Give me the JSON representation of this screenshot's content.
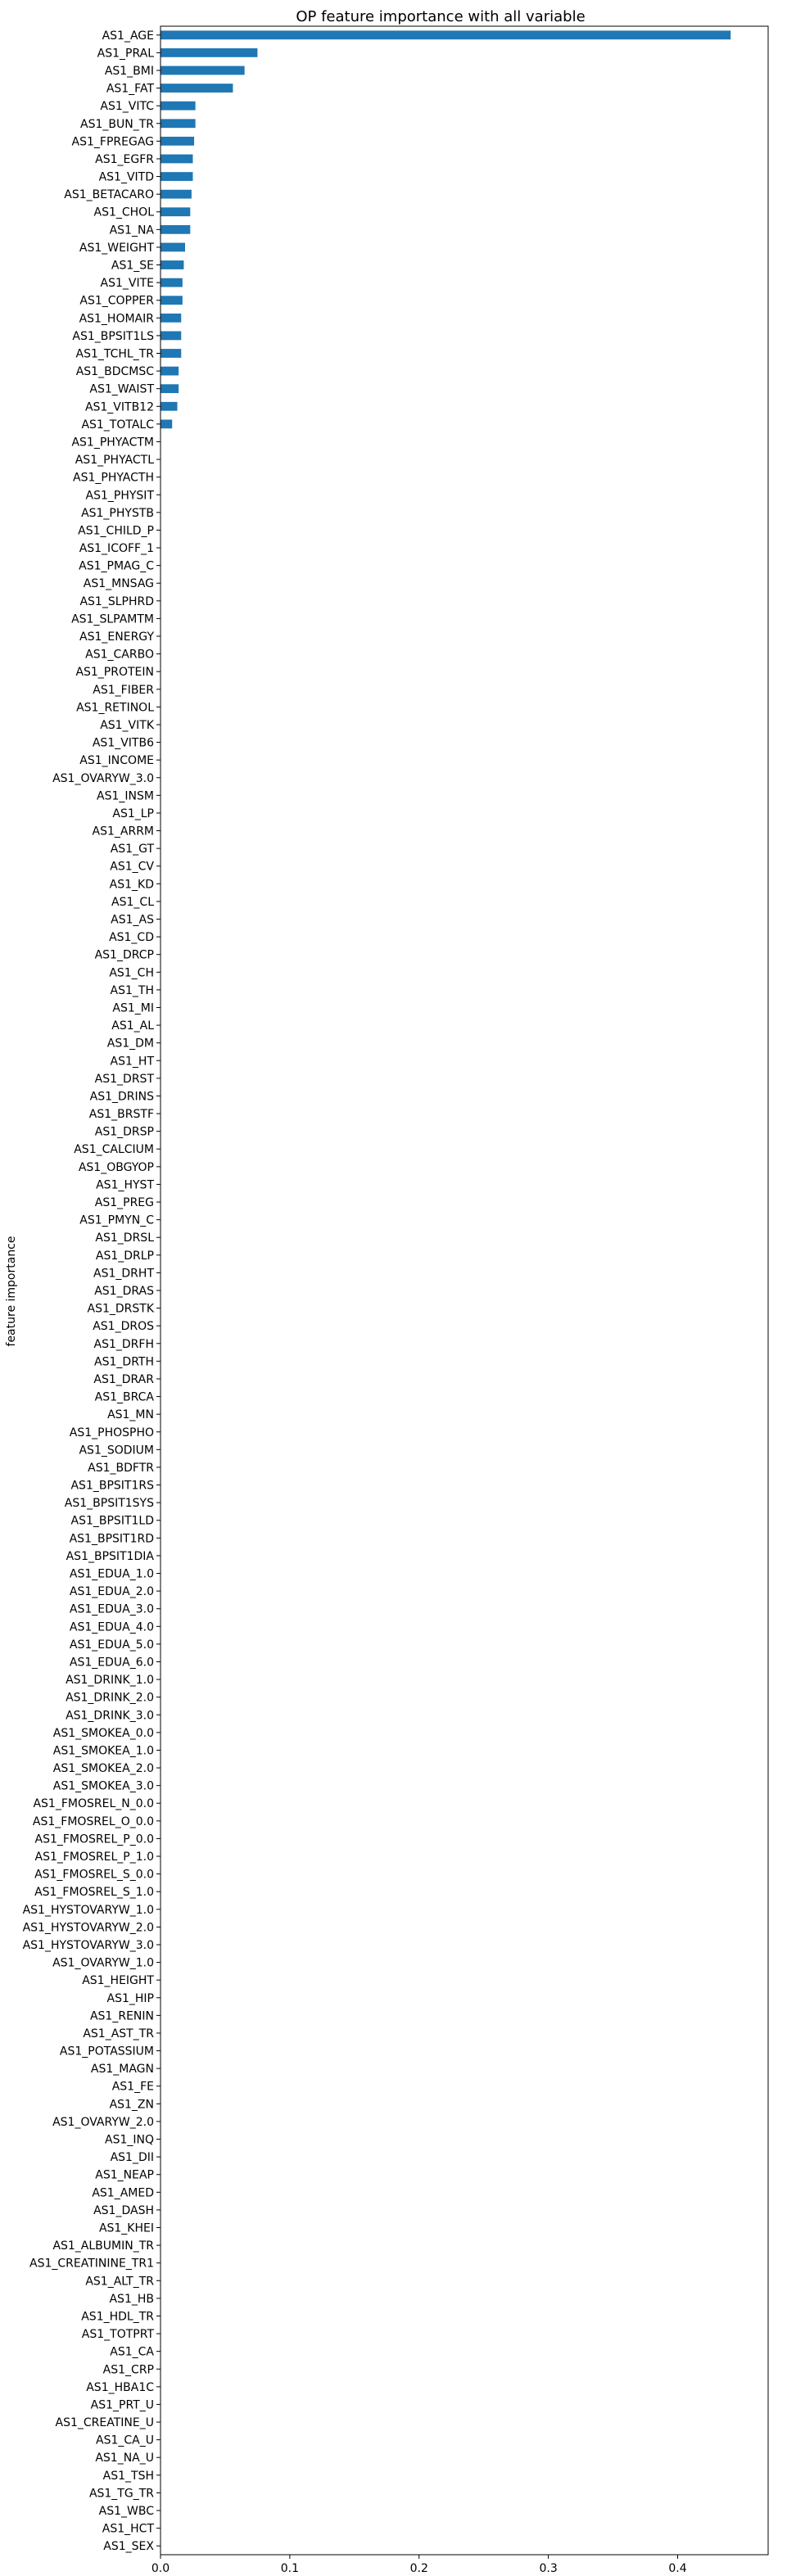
{
  "chart_data": {
    "type": "bar",
    "orientation": "horizontal",
    "title": "OP feature importance with all variable",
    "xlabel": "",
    "ylabel": "feature importance",
    "xlim": [
      0,
      0.47
    ],
    "xticks": [
      "0.0",
      "0.1",
      "0.2",
      "0.3",
      "0.4"
    ],
    "xtick_values": [
      0,
      0.1,
      0.2,
      0.3,
      0.4
    ],
    "grid": false,
    "bar_color": "#1f77b4",
    "categories": [
      "AS1_AGE",
      "AS1_PRAL",
      "AS1_BMI",
      "AS1_FAT",
      "AS1_VITC",
      "AS1_BUN_TR",
      "AS1_FPREGAG",
      "AS1_EGFR",
      "AS1_VITD",
      "AS1_BETACARO",
      "AS1_CHOL",
      "AS1_NA",
      "AS1_WEIGHT",
      "AS1_SE",
      "AS1_VITE",
      "AS1_COPPER",
      "AS1_HOMAIR",
      "AS1_BPSIT1LS",
      "AS1_TCHL_TR",
      "AS1_BDCMSC",
      "AS1_WAIST",
      "AS1_VITB12",
      "AS1_TOTALC",
      "AS1_PHYACTM",
      "AS1_PHYACTL",
      "AS1_PHYACTH",
      "AS1_PHYSIT",
      "AS1_PHYSTB",
      "AS1_CHILD_P",
      "AS1_ICOFF_1",
      "AS1_PMAG_C",
      "AS1_MNSAG",
      "AS1_SLPHRD",
      "AS1_SLPAMTM",
      "AS1_ENERGY",
      "AS1_CARBO",
      "AS1_PROTEIN",
      "AS1_FIBER",
      "AS1_RETINOL",
      "AS1_VITK",
      "AS1_VITB6",
      "AS1_INCOME",
      "AS1_OVARYW_3.0",
      "AS1_INSM",
      "AS1_LP",
      "AS1_ARRM",
      "AS1_GT",
      "AS1_CV",
      "AS1_KD",
      "AS1_CL",
      "AS1_AS",
      "AS1_CD",
      "AS1_DRCP",
      "AS1_CH",
      "AS1_TH",
      "AS1_MI",
      "AS1_AL",
      "AS1_DM",
      "AS1_HT",
      "AS1_DRST",
      "AS1_DRINS",
      "AS1_BRSTF",
      "AS1_DRSP",
      "AS1_CALCIUM",
      "AS1_OBGYOP",
      "AS1_HYST",
      "AS1_PREG",
      "AS1_PMYN_C",
      "AS1_DRSL",
      "AS1_DRLP",
      "AS1_DRHT",
      "AS1_DRAS",
      "AS1_DRSTK",
      "AS1_DROS",
      "AS1_DRFH",
      "AS1_DRTH",
      "AS1_DRAR",
      "AS1_BRCA",
      "AS1_MN",
      "AS1_PHOSPHO",
      "AS1_SODIUM",
      "AS1_BDFTR",
      "AS1_BPSIT1RS",
      "AS1_BPSIT1SYS",
      "AS1_BPSIT1LD",
      "AS1_BPSIT1RD",
      "AS1_BPSIT1DIA",
      "AS1_EDUA_1.0",
      "AS1_EDUA_2.0",
      "AS1_EDUA_3.0",
      "AS1_EDUA_4.0",
      "AS1_EDUA_5.0",
      "AS1_EDUA_6.0",
      "AS1_DRINK_1.0",
      "AS1_DRINK_2.0",
      "AS1_DRINK_3.0",
      "AS1_SMOKEA_0.0",
      "AS1_SMOKEA_1.0",
      "AS1_SMOKEA_2.0",
      "AS1_SMOKEA_3.0",
      "AS1_FMOSREL_N_0.0",
      "AS1_FMOSREL_O_0.0",
      "AS1_FMOSREL_P_0.0",
      "AS1_FMOSREL_P_1.0",
      "AS1_FMOSREL_S_0.0",
      "AS1_FMOSREL_S_1.0",
      "AS1_HYSTOVARYW_1.0",
      "AS1_HYSTOVARYW_2.0",
      "AS1_HYSTOVARYW_3.0",
      "AS1_OVARYW_1.0",
      "AS1_HEIGHT",
      "AS1_HIP",
      "AS1_RENIN",
      "AS1_AST_TR",
      "AS1_POTASSIUM",
      "AS1_MAGN",
      "AS1_FE",
      "AS1_ZN",
      "AS1_OVARYW_2.0",
      "AS1_INQ",
      "AS1_DII",
      "AS1_NEAP",
      "AS1_AMED",
      "AS1_DASH",
      "AS1_KHEI",
      "AS1_ALBUMIN_TR",
      "AS1_CREATININE_TR1",
      "AS1_ALT_TR",
      "AS1_HB",
      "AS1_HDL_TR",
      "AS1_TOTPRT",
      "AS1_CA",
      "AS1_CRP",
      "AS1_HBA1C",
      "AS1_PRT_U",
      "AS1_CREATINE_U",
      "AS1_CA_U",
      "AS1_NA_U",
      "AS1_TSH",
      "AS1_TG_TR",
      "AS1_WBC",
      "AS1_HCT",
      "AS1_SEX"
    ],
    "values": [
      0.441,
      0.075,
      0.065,
      0.056,
      0.027,
      0.027,
      0.026,
      0.025,
      0.025,
      0.024,
      0.023,
      0.023,
      0.019,
      0.018,
      0.017,
      0.017,
      0.016,
      0.016,
      0.016,
      0.014,
      0.014,
      0.013,
      0.009,
      0,
      0,
      0,
      0,
      0,
      0,
      0,
      0,
      0,
      0,
      0,
      0,
      0,
      0,
      0,
      0,
      0,
      0,
      0,
      0,
      0,
      0,
      0,
      0,
      0,
      0,
      0,
      0,
      0,
      0,
      0,
      0,
      0,
      0,
      0,
      0,
      0,
      0,
      0,
      0,
      0,
      0,
      0,
      0,
      0,
      0,
      0,
      0,
      0,
      0,
      0,
      0,
      0,
      0,
      0,
      0,
      0,
      0,
      0,
      0,
      0,
      0,
      0,
      0,
      0,
      0,
      0,
      0,
      0,
      0,
      0,
      0,
      0,
      0,
      0,
      0,
      0,
      0,
      0,
      0,
      0,
      0,
      0,
      0,
      0,
      0,
      0,
      0,
      0,
      0,
      0,
      0,
      0,
      0,
      0,
      0,
      0,
      0,
      0,
      0,
      0,
      0,
      0,
      0,
      0,
      0,
      0,
      0,
      0,
      0,
      0,
      0,
      0,
      0,
      0,
      0,
      0,
      0,
      0,
      0,
      0
    ]
  }
}
